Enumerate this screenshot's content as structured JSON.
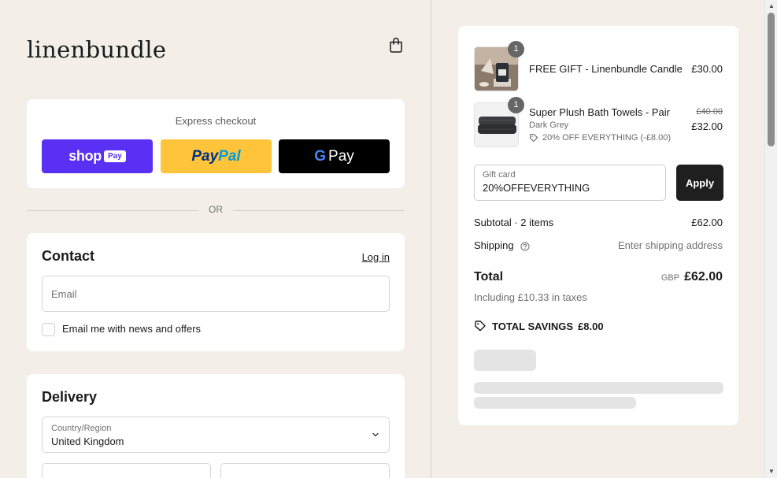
{
  "brand": {
    "logo": "linenbundle"
  },
  "express": {
    "title": "Express checkout",
    "shop_pay": {
      "word": "shop",
      "badge": "Pay",
      "color": "#5a31f4"
    },
    "paypal": {
      "part1": "Pay",
      "part2": "Pal",
      "color": "#ffc439"
    },
    "gpay": {
      "g": "G",
      "text": "Pay",
      "color": "#000000"
    }
  },
  "divider": {
    "text": "OR"
  },
  "contact": {
    "title": "Contact",
    "login_link": "Log in",
    "email_placeholder": "Email",
    "newsletter_label": "Email me with news and offers"
  },
  "delivery": {
    "title": "Delivery",
    "country_label": "Country/Region",
    "country_value": "United Kingdom"
  },
  "summary": {
    "items": [
      {
        "quantity": "1",
        "name": "FREE GIFT - Linenbundle Candle",
        "price": "£30.00"
      },
      {
        "quantity": "1",
        "name": "Super Plush Bath Towels - Pair",
        "variant": "Dark Grey",
        "discount": "20% OFF EVERYTHING (-£8.00)",
        "original_price": "£40.00",
        "price": "£32.00"
      }
    ],
    "gift_card": {
      "label": "Gift card",
      "value": "20%OFFEVERYTHING"
    },
    "apply_label": "Apply",
    "subtotal_label": "Subtotal · 2 items",
    "subtotal_value": "£62.00",
    "shipping_label": "Shipping",
    "shipping_value": "Enter shipping address",
    "total_label": "Total",
    "currency": "GBP",
    "total_value": "£62.00",
    "taxes_note": "Including £10.33 in taxes",
    "savings_label": "TOTAL SAVINGS",
    "savings_value": "£8.00"
  }
}
